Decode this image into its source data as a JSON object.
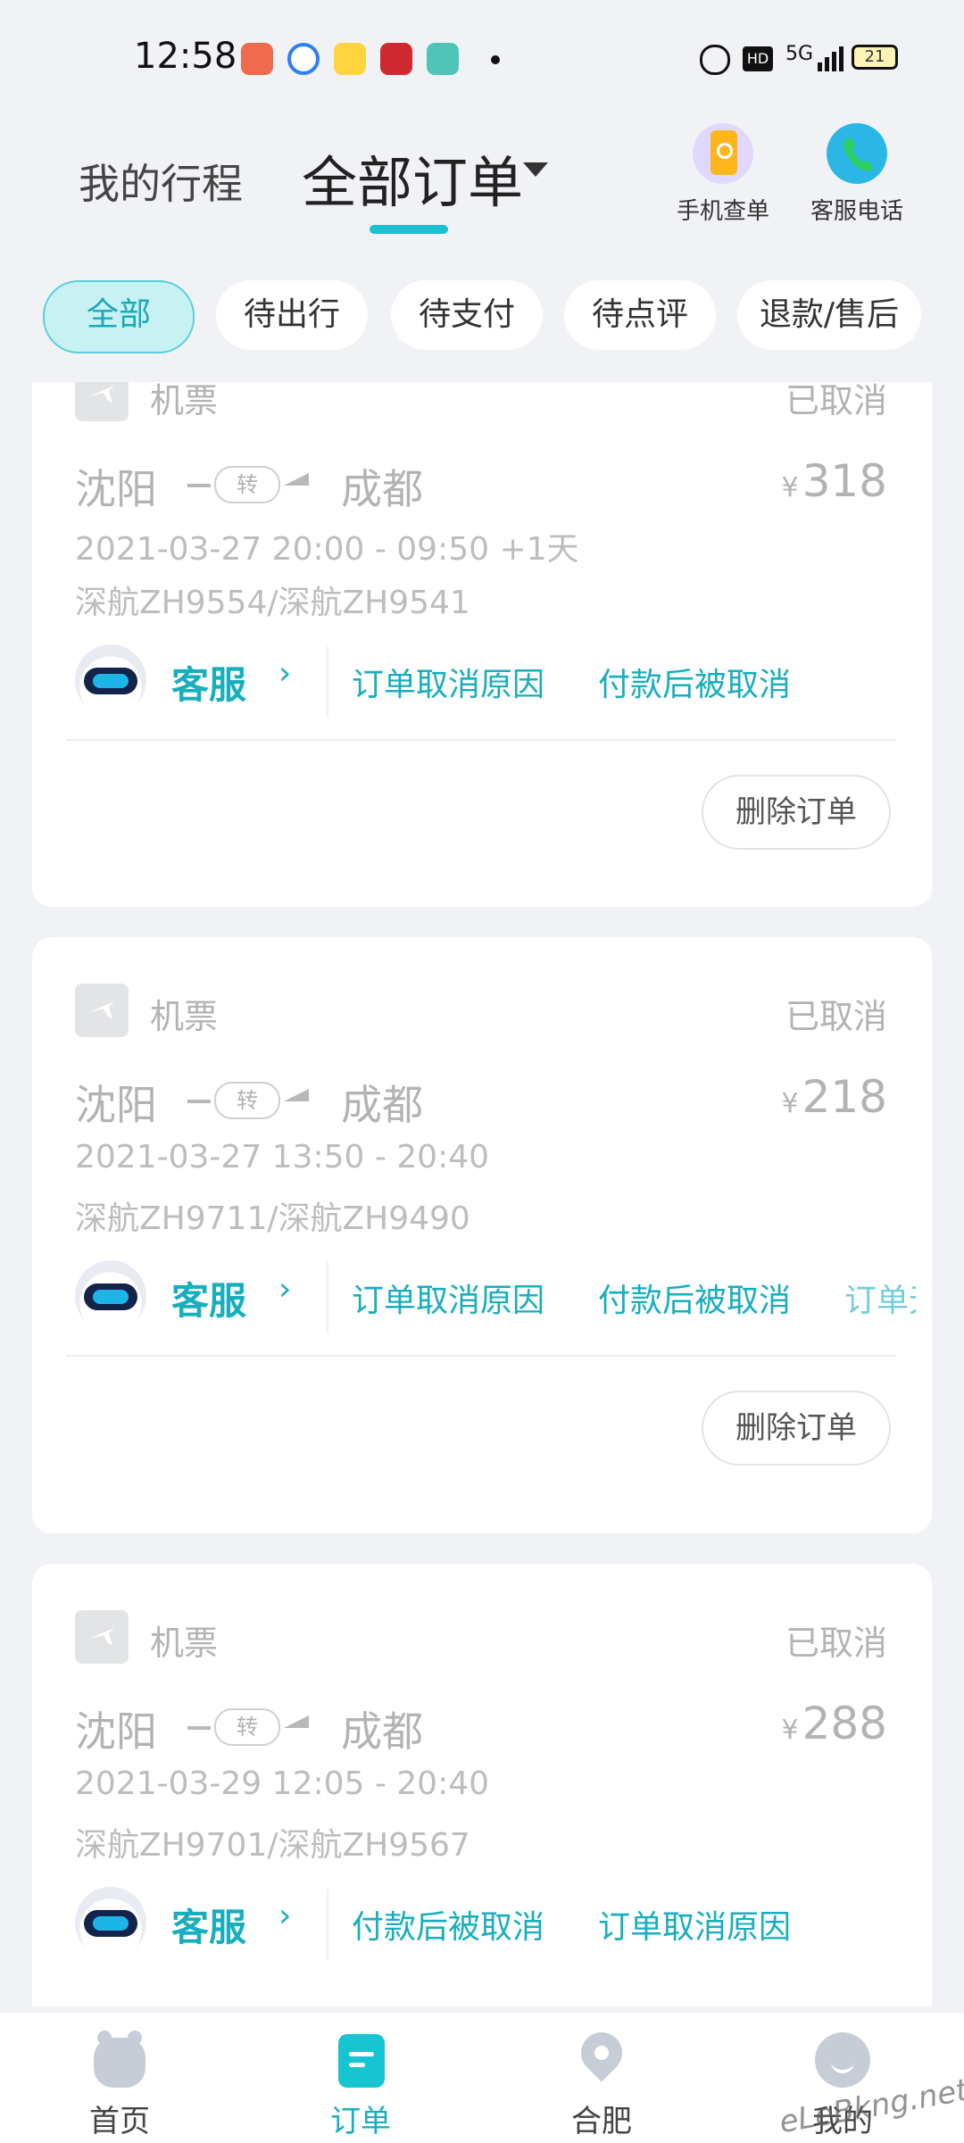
{
  "status_bar": {
    "time": "12:58",
    "signal": "5G",
    "battery": "21"
  },
  "header": {
    "tab_my_trips": "我的行程",
    "tab_all_orders": "全部订单",
    "action_phone_lookup": "手机查单",
    "action_service_phone": "客服电话"
  },
  "filters": [
    "全部",
    "待出行",
    "待支付",
    "待点评",
    "退款/售后"
  ],
  "orders": [
    {
      "category": "机票",
      "status": "已取消",
      "from": "沈阳",
      "transfer": "转",
      "to": "成都",
      "currency": "¥",
      "price": "318",
      "datetime": "2021-03-27 20:00 - 09:50 +1天",
      "flights": "深航ZH9554/深航ZH9541",
      "service_label": "客服",
      "links": [
        "订单取消原因",
        "付款后被取消"
      ],
      "delete_label": "删除订单"
    },
    {
      "category": "机票",
      "status": "已取消",
      "from": "沈阳",
      "transfer": "转",
      "to": "成都",
      "currency": "¥",
      "price": "218",
      "datetime": "2021-03-27 13:50 - 20:40",
      "flights": "深航ZH9711/深航ZH9490",
      "service_label": "客服",
      "links": [
        "订单取消原因",
        "付款后被取消",
        "订单无"
      ],
      "delete_label": "删除订单"
    },
    {
      "category": "机票",
      "status": "已取消",
      "from": "沈阳",
      "transfer": "转",
      "to": "成都",
      "currency": "¥",
      "price": "288",
      "datetime": "2021-03-29 12:05 - 20:40",
      "flights": "深航ZH9701/深航ZH9567",
      "service_label": "客服",
      "links": [
        "付款后被取消",
        "订单取消原因"
      ]
    }
  ],
  "bottom_nav": [
    "首页",
    "订单",
    "合肥",
    "我的"
  ],
  "watermark": "eLeBkng.net",
  "colors": {
    "accent": "#17aebd",
    "chip_active_bg": "#c8f1f3",
    "muted_text": "#b3b3b3",
    "page_bg": "#f1f2f6"
  }
}
